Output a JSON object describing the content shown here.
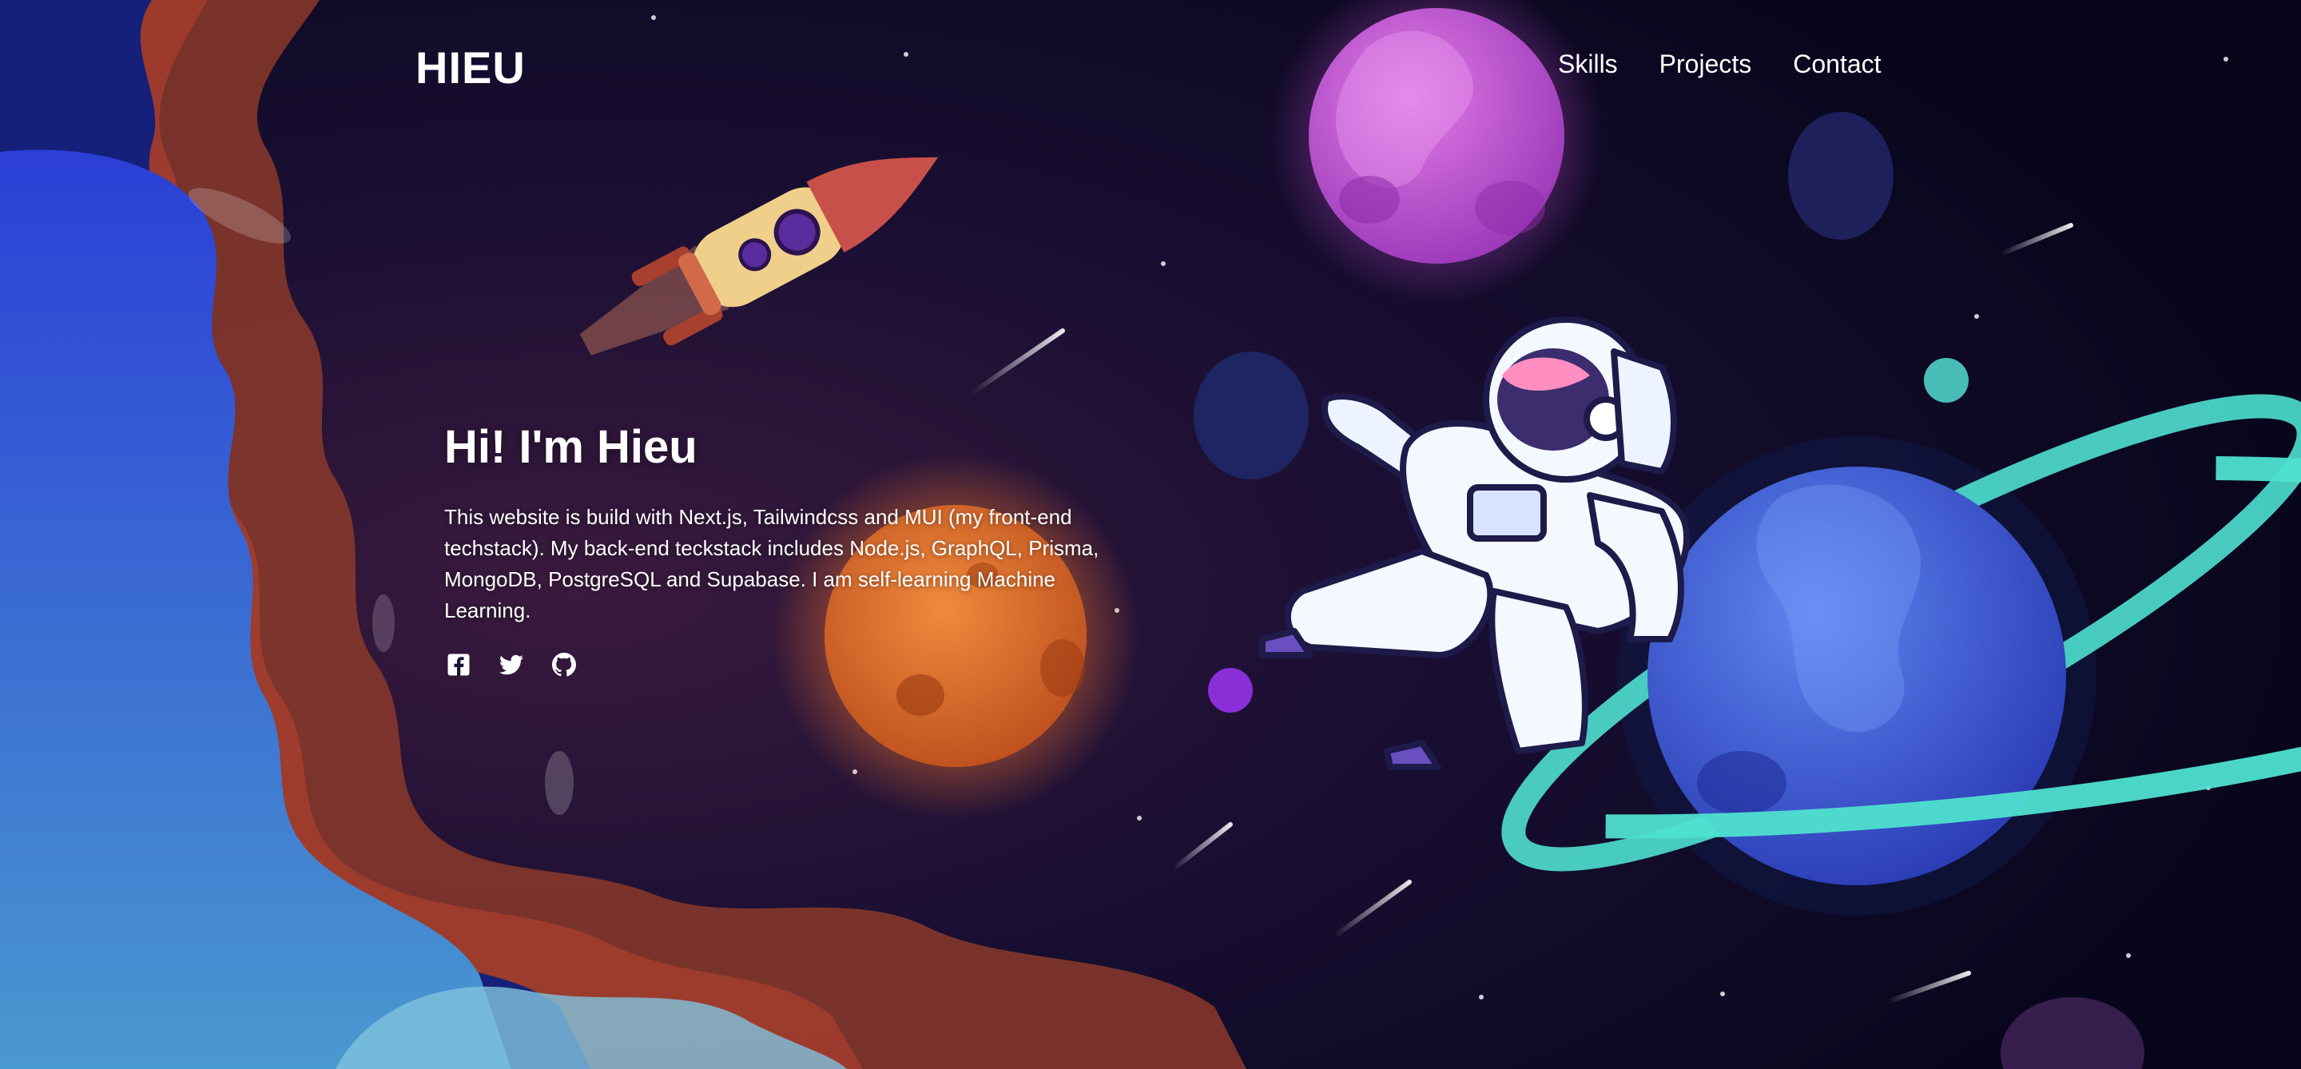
{
  "site": {
    "logo": "HIEU"
  },
  "nav": {
    "items": [
      {
        "label": "Skills"
      },
      {
        "label": "Projects"
      },
      {
        "label": "Contact"
      }
    ]
  },
  "hero": {
    "title": "Hi! I'm Hieu",
    "description": "This website is build with Next.js, Tailwindcss and MUI (my front-end techstack). My back-end teckstack includes Node.js, GraphQL, Prisma, MongoDB, PostgreSQL and Supabase. I am self-learning Machine Learning."
  },
  "socials": [
    {
      "icon": "facebook-icon"
    },
    {
      "icon": "twitter-icon"
    },
    {
      "icon": "github-icon"
    }
  ],
  "colors": {
    "background": "#07061a",
    "text": "#ffffff",
    "ring": "#4fe0d0",
    "planet_blue": "#3a5fd6",
    "planet_pink": "#c653d6",
    "planet_orange": "#d9652a"
  }
}
